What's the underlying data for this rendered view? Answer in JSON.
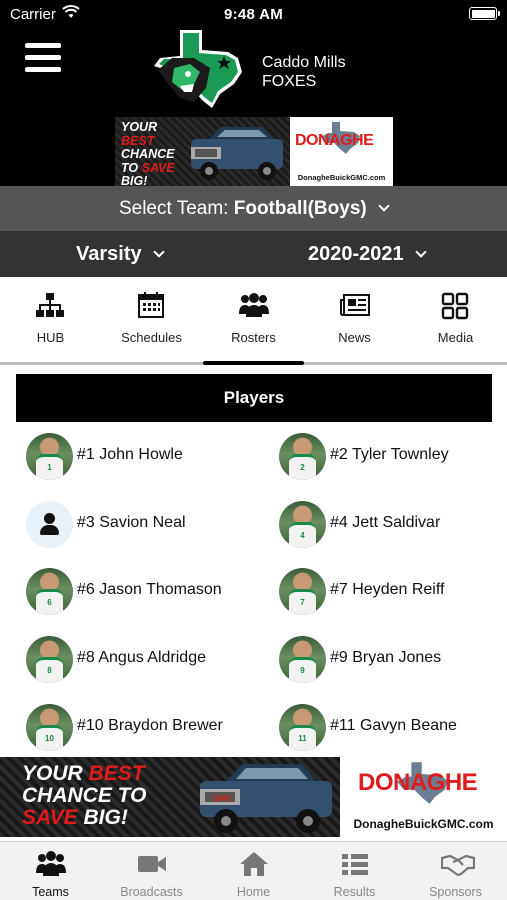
{
  "status_bar": {
    "carrier": "Carrier",
    "time": "9:48 AM"
  },
  "header": {
    "school_name": "Caddo Mills",
    "mascot": "FOXES",
    "logo_icon": "fox-texas-logo"
  },
  "ad_top": {
    "line1": "YOUR",
    "line2": "BEST",
    "line3": "CHANCE",
    "line4": "TO",
    "line5": "SAVE",
    "line6": "BIG!",
    "brand": "DONAGHE",
    "url": "DonagheBuickGMC.com"
  },
  "team_select": {
    "label": "Select Team:",
    "value": "Football(Boys)"
  },
  "filters": {
    "level": "Varsity",
    "season": "2020-2021"
  },
  "nav": {
    "items": [
      {
        "label": "HUB",
        "icon": "org-chart-icon"
      },
      {
        "label": "Schedules",
        "icon": "calendar-icon"
      },
      {
        "label": "Rosters",
        "icon": "people-icon"
      },
      {
        "label": "News",
        "icon": "newspaper-icon"
      },
      {
        "label": "Media",
        "icon": "grid-icon"
      }
    ],
    "active": "Rosters"
  },
  "players_header": "Players",
  "players": [
    {
      "name": "#1 John Howle",
      "num": "1",
      "photo": true
    },
    {
      "name": "#2 Tyler Townley",
      "num": "2",
      "photo": true
    },
    {
      "name": "#3 Savion Neal",
      "num": "3",
      "photo": false
    },
    {
      "name": "#4 Jett Saldivar",
      "num": "4",
      "photo": true
    },
    {
      "name": "#6 Jason Thomason",
      "num": "6",
      "photo": true
    },
    {
      "name": "#7 Heyden Reiff",
      "num": "7",
      "photo": true
    },
    {
      "name": "#8 Angus Aldridge",
      "num": "8",
      "photo": true
    },
    {
      "name": "#9 Bryan Jones",
      "num": "9",
      "photo": true
    },
    {
      "name": "#10 Braydon Brewer",
      "num": "10",
      "photo": true
    },
    {
      "name": "#11 Gavyn Beane",
      "num": "11",
      "photo": true
    }
  ],
  "ad_bottom": {
    "line1a": "YOUR",
    "line1b": "BEST",
    "line2": "CHANCE TO",
    "line3a": "SAVE",
    "line3b": "BIG!",
    "brand": "DONAGHE",
    "url": "DonagheBuickGMC.com"
  },
  "tabbar": {
    "tabs": [
      {
        "label": "Teams",
        "icon": "team-icon"
      },
      {
        "label": "Broadcasts",
        "icon": "video-camera-icon"
      },
      {
        "label": "Home",
        "icon": "home-icon"
      },
      {
        "label": "Results",
        "icon": "list-icon"
      },
      {
        "label": "Sponsors",
        "icon": "handshake-icon"
      }
    ],
    "active": "Teams"
  },
  "colors": {
    "accent_green": "#1a8a4a",
    "ad_red": "#e11b1b",
    "header_bg": "#000000"
  }
}
